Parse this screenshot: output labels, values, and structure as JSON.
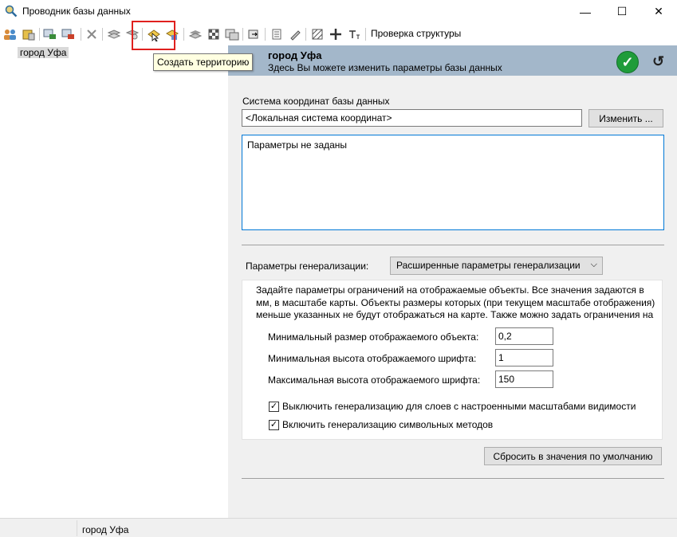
{
  "window": {
    "title": "Проводник базы данных",
    "minimize_glyph": "—",
    "maximize_glyph": "☐",
    "close_glyph": "✕"
  },
  "toolbar": {
    "check_structure_label": "Проверка структуры",
    "tooltip": "Создать территорию",
    "icons": [
      "users-icon",
      "database-icon",
      "layer-add-icon",
      "layer-remove-icon",
      "delete-icon",
      "copy-layers-icon",
      "copy-layers-alt-icon",
      "create-territory-icon",
      "territory-settings-icon",
      "layers-icon",
      "grid-icon",
      "table-icon",
      "export-icon",
      "document-icon",
      "pen-icon",
      "hatch-icon",
      "cross-icon",
      "text-format-icon"
    ]
  },
  "tree": {
    "selected_node": "город Уфа"
  },
  "panel": {
    "header_title": "город Уфа",
    "header_subtitle": "Здесь Вы можете изменить параметры базы данных",
    "crs_label": "Система координат базы данных",
    "crs_value": "<Локальная система координат>",
    "change_button": "Изменить ...",
    "params_text": "Параметры не заданы",
    "generalization_label": "Параметры генерализации:",
    "generalization_option": "Расширенные параметры генерализации",
    "generalization_description": "Задайте параметры ограничений на отображаемые объекты. Все значения задаются в мм, в масштабе карты. Объекты размеры которых (при текущем масштабе отображения) меньше указанных не будут отображаться на карте. Также можно задать ограничения на",
    "fields": [
      {
        "label": "Минимальный размер отображаемого объекта:",
        "value": "0,2"
      },
      {
        "label": "Минимальная высота отображаемого шрифта:",
        "value": "1"
      },
      {
        "label": "Максимальная высота отображаемого шрифта:",
        "value": "150"
      }
    ],
    "checkboxes": [
      {
        "label": "Выключить генерализацию для слоев с настроенными масштабами видимости",
        "checked": true
      },
      {
        "label": "Включить генерализацию символьных методов",
        "checked": true
      }
    ],
    "reset_button": "Сбросить в значения по умолчанию"
  },
  "statusbar": {
    "text": "город Уфа"
  },
  "colors": {
    "header_band": "#a3b7ca",
    "ok_green": "#1f9c3a",
    "highlight_red": "#e0201e",
    "tooltip_bg": "#ffffe1"
  }
}
